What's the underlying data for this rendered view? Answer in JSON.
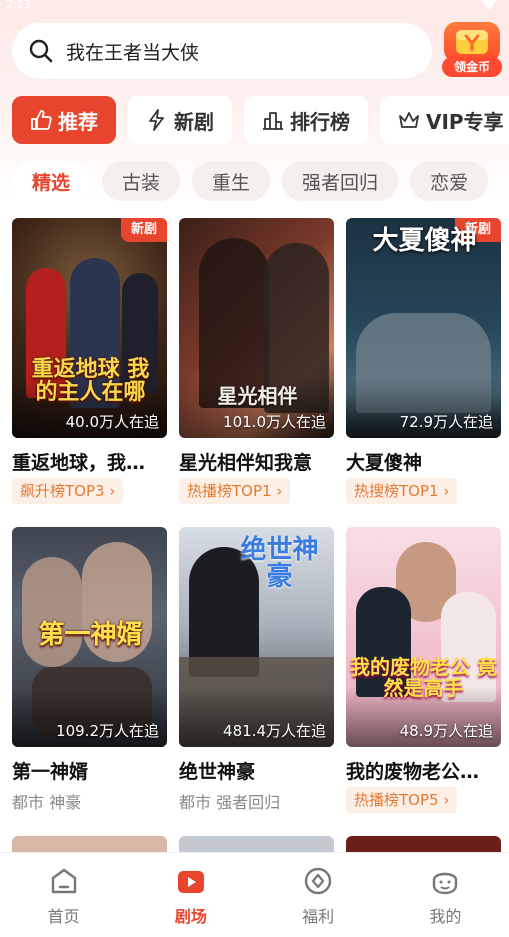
{
  "status": {
    "time": "2:23"
  },
  "search": {
    "placeholder": "我在王者当大侠",
    "icon": "search-icon"
  },
  "coin": {
    "label": "领金币"
  },
  "main_tabs": [
    {
      "label": "推荐",
      "icon": "thumbs-up-icon",
      "active": true
    },
    {
      "label": "新剧",
      "icon": "lightning-icon",
      "active": false
    },
    {
      "label": "排行榜",
      "icon": "bar-chart-icon",
      "active": false
    },
    {
      "label": "VIP专享",
      "icon": "crown-icon",
      "active": false
    }
  ],
  "sub_tabs": [
    {
      "label": "精选",
      "active": true
    },
    {
      "label": "古装",
      "active": false
    },
    {
      "label": "重生",
      "active": false
    },
    {
      "label": "强者回归",
      "active": false
    },
    {
      "label": "恋爱",
      "active": false
    }
  ],
  "dramas": [
    {
      "title": "重返地球，我…",
      "watching": "40.0万人在追",
      "tag": "新剧",
      "rank": "飙升榜TOP3 ›",
      "overlay": "重返地球 我的主人在哪"
    },
    {
      "title": "星光相伴知我意",
      "watching": "101.0万人在追",
      "tag": "",
      "rank": "热播榜TOP1 ›",
      "overlay": "星光相伴"
    },
    {
      "title": "大夏傻神",
      "watching": "72.9万人在追",
      "tag": "新剧",
      "rank": "热搜榜TOP1 ›",
      "overlay": "大夏傻神"
    },
    {
      "title": "第一神婿",
      "watching": "109.2万人在追",
      "tag": "",
      "genre": "都市 神豪",
      "overlay": "第一神婿"
    },
    {
      "title": "绝世神豪",
      "watching": "481.4万人在追",
      "tag": "",
      "genre": "都市 强者回归",
      "overlay": "绝世神豪"
    },
    {
      "title": "我的废物老公…",
      "watching": "48.9万人在追",
      "tag": "",
      "rank": "热播榜TOP5 ›",
      "overlay": "我的废物老公 竟然是高手"
    }
  ],
  "nav": [
    {
      "label": "首页",
      "icon": "home-icon",
      "active": false
    },
    {
      "label": "剧场",
      "icon": "play-icon",
      "active": true
    },
    {
      "label": "福利",
      "icon": "gift-compass-icon",
      "active": false
    },
    {
      "label": "我的",
      "icon": "profile-icon",
      "active": false
    }
  ],
  "colors": {
    "accent": "#e8452f",
    "rank_text": "#e57a34",
    "rank_bg": "#fcefe6"
  }
}
